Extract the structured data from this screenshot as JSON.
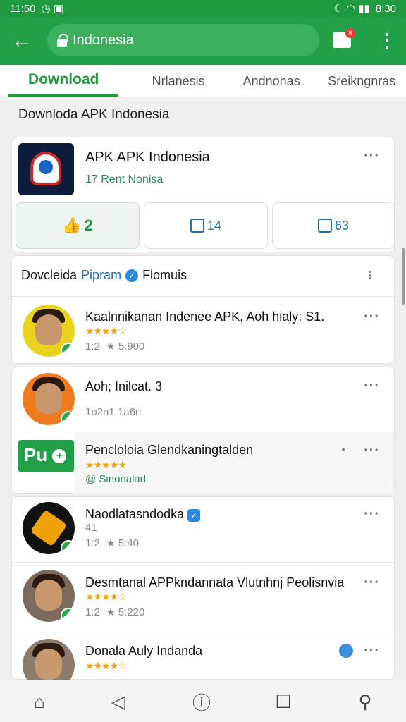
{
  "status_bar": {
    "time": "11:50",
    "right_time": "8:30"
  },
  "browser": {
    "url": "Indonesia",
    "notif_count": "8"
  },
  "tabs": [
    {
      "label": "Download"
    },
    {
      "label": "Nrlanesis"
    },
    {
      "label": "Andnonas"
    },
    {
      "label": "Sreikngnras"
    }
  ],
  "section_title": "Downloda APK  Indonesia",
  "app": {
    "title": "APK APK Indonesia",
    "subtitle": "17 Rent Nonisa",
    "actions": [
      {
        "label": "2",
        "icon": "thumbs-up-icon"
      },
      {
        "label": "14",
        "icon": "share-icon"
      },
      {
        "label": "63",
        "icon": "external-icon"
      }
    ]
  },
  "list_header": {
    "part1": "Dovcleida",
    "part2": "Pipram",
    "part3": "Flomuis"
  },
  "items": [
    {
      "title": "Kaalnnikanan Indenee APK, Aoh hialy: S1.",
      "rating": "★★★★☆",
      "meta1": "1:2",
      "meta2": "★ 5.900"
    },
    {
      "title": "Aoh; Inilcat. 3",
      "meta": "1o2n1 1a6n"
    },
    {
      "title": "Pencloloia Glendkaningtalden",
      "rating": "★★★★★",
      "meta": "@ Sinonalad",
      "logo_text": "Pu"
    },
    {
      "title": "Naodlatasndodka",
      "sub": "41",
      "meta1": "1:2",
      "meta2": "★ 5:40"
    },
    {
      "title": "Desmtanal APPkndannata Vlutnhnj Peolisnvia",
      "rating": "★★★★☆",
      "meta1": "1:2",
      "meta2": "★ 5:220"
    },
    {
      "title": "Donala Auly Indanda",
      "rating": "★★★★☆"
    }
  ],
  "colors": {
    "brand": "#1f9a3f",
    "accent": "#1f6fb2"
  }
}
